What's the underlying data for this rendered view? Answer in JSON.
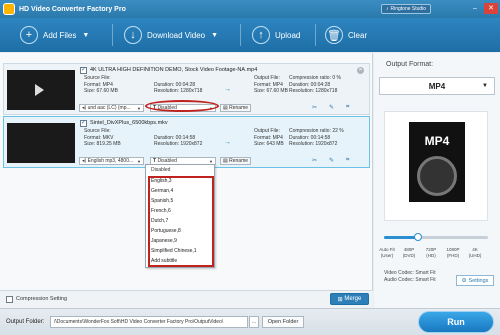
{
  "window": {
    "title": "HD Video Converter Factory Pro",
    "ringtone_label": "Ringtone Studio"
  },
  "toolbar": {
    "add_files": "Add Files",
    "download_video": "Download Video",
    "upload": "Upload",
    "clear": "Clear"
  },
  "items": [
    {
      "filename": "4K ULTRA HIGH DEFINITION DEMO, Stock Video Footage-NA.mp4",
      "src_label": "Source File:",
      "src_format": "Format: MP4",
      "src_duration": "Duration: 00:04:28",
      "src_size": "Size: 67.60 MB",
      "src_resolution": "Resolution: 1280x718",
      "out_label": "Output File:",
      "out_format": "Format: MP4",
      "out_duration": "Duration: 00:04:28",
      "out_size": "Size: 67.60 MB",
      "out_resolution": "Resolution: 1280x718",
      "compression": "Compression ratio: 0 %",
      "audio": "und aac (LC) (mp...",
      "subtitle": "Disabled",
      "rename": "Rename"
    },
    {
      "filename": "Sintel_DivXPlus_6500kbps.mkv",
      "src_label": "Source File:",
      "src_format": "Format: MKV",
      "src_duration": "Duration: 00:14:58",
      "src_size": "Size: 819.25 MB",
      "src_resolution": "Resolution: 1920x872",
      "out_label": "Output File:",
      "out_format": "Format: MP4",
      "out_duration": "Duration: 00:14:58",
      "out_size": "Size: 643 MB",
      "out_resolution": "Resolution: 1920x872",
      "compression": "Compression ratio: 22 %",
      "audio": "English mp3, 4800...",
      "subtitle": "Disabled",
      "rename": "Rename"
    }
  ],
  "subtitle_dropdown": {
    "first": "Disabled",
    "options": [
      "English,3",
      "German,4",
      "Spanish,5",
      "French,6",
      "Dutch,7",
      "Portuguese,8",
      "Japanese,9",
      "Simplified Chinese,1",
      "Add subtitle"
    ]
  },
  "bottom": {
    "compression_setting": "Compression Setting",
    "merge": "Merge"
  },
  "right": {
    "output_format_label": "Output Format:",
    "format": "MP4",
    "tile_text": "MP4",
    "quality_level_percent": 33,
    "qualities": [
      {
        "name": "Auto Fit",
        "sub": "(User)"
      },
      {
        "name": "480P",
        "sub": "(DVD)"
      },
      {
        "name": "720P",
        "sub": "(HD)"
      },
      {
        "name": "1080P",
        "sub": "(FHD)"
      },
      {
        "name": "4K",
        "sub": "(UHD)"
      }
    ],
    "video_codec": "Video Codec: Smart Fit",
    "audio_codec": "Audio Codec: Smart Fit",
    "settings": "Settings"
  },
  "footer": {
    "output_folder_label": "Output Folder:",
    "path": "/\\Documents\\WonderFox Soft\\HD Video Converter Factory Pro\\OutputVideo\\",
    "open_folder": "Open Folder",
    "run": "Run"
  }
}
